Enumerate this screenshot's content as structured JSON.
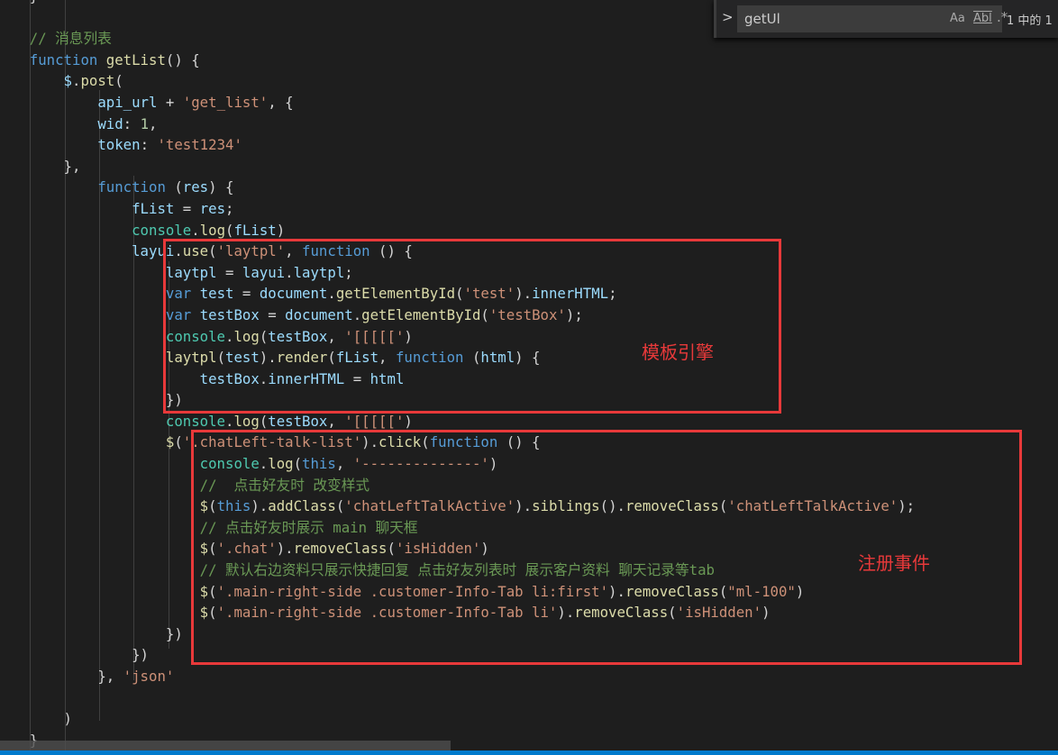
{
  "find_widget": {
    "query": "getUl",
    "match_case_label": "Aa",
    "whole_word_label": "Abl",
    "regex_label": ".*",
    "result_count": "1 中的 1"
  },
  "annotations": {
    "template_engine_label": "模板引擎",
    "register_events_label": "注册事件",
    "color": "#e8393a"
  },
  "code_lines": [
    [
      [
        "p",
        "    }"
      ]
    ],
    [],
    [
      [
        "c",
        "    // 消息列表"
      ]
    ],
    [
      [
        "k",
        "    function "
      ],
      [
        "f",
        "getList"
      ],
      [
        "p",
        "() {"
      ]
    ],
    [
      [
        "v",
        "        $"
      ],
      [
        "p",
        "."
      ],
      [
        "f",
        "post"
      ],
      [
        "p",
        "("
      ]
    ],
    [
      [
        "v",
        "            api_url"
      ],
      [
        "p",
        " + "
      ],
      [
        "s",
        "'get_list'"
      ],
      [
        "p",
        ", {"
      ]
    ],
    [
      [
        "v",
        "            wid"
      ],
      [
        "p",
        ": "
      ],
      [
        "n",
        "1"
      ],
      [
        "p",
        ","
      ]
    ],
    [
      [
        "v",
        "            token"
      ],
      [
        "p",
        ": "
      ],
      [
        "s",
        "'test1234'"
      ]
    ],
    [
      [
        "p",
        "        },"
      ]
    ],
    [
      [
        "k",
        "            function "
      ],
      [
        "p",
        "("
      ],
      [
        "v",
        "res"
      ],
      [
        "p",
        ") {"
      ]
    ],
    [
      [
        "v",
        "                fList"
      ],
      [
        "p",
        " = "
      ],
      [
        "v",
        "res"
      ],
      [
        "p",
        ";"
      ]
    ],
    [
      [
        "t",
        "                console"
      ],
      [
        "p",
        "."
      ],
      [
        "f",
        "log"
      ],
      [
        "p",
        "("
      ],
      [
        "v",
        "fList"
      ],
      [
        "p",
        ")"
      ]
    ],
    [
      [
        "v",
        "                layui"
      ],
      [
        "p",
        "."
      ],
      [
        "f",
        "use"
      ],
      [
        "p",
        "("
      ],
      [
        "s",
        "'laytpl'"
      ],
      [
        "p",
        ", "
      ],
      [
        "k",
        "function"
      ],
      [
        "p",
        " () {"
      ]
    ],
    [
      [
        "v",
        "                    laytpl"
      ],
      [
        "p",
        " = "
      ],
      [
        "v",
        "layui"
      ],
      [
        "p",
        "."
      ],
      [
        "v",
        "laytpl"
      ],
      [
        "p",
        ";"
      ]
    ],
    [
      [
        "k",
        "                    var "
      ],
      [
        "v",
        "test"
      ],
      [
        "p",
        " = "
      ],
      [
        "v",
        "document"
      ],
      [
        "p",
        "."
      ],
      [
        "f",
        "getElementById"
      ],
      [
        "p",
        "("
      ],
      [
        "s",
        "'test'"
      ],
      [
        "p",
        ")."
      ],
      [
        "v",
        "innerHTML"
      ],
      [
        "p",
        ";"
      ]
    ],
    [
      [
        "k",
        "                    var "
      ],
      [
        "v",
        "testBox"
      ],
      [
        "p",
        " = "
      ],
      [
        "v",
        "document"
      ],
      [
        "p",
        "."
      ],
      [
        "f",
        "getElementById"
      ],
      [
        "p",
        "("
      ],
      [
        "s",
        "'testBox'"
      ],
      [
        "p",
        ");"
      ]
    ],
    [
      [
        "t",
        "                    console"
      ],
      [
        "p",
        "."
      ],
      [
        "f",
        "log"
      ],
      [
        "p",
        "("
      ],
      [
        "v",
        "testBox"
      ],
      [
        "p",
        ", "
      ],
      [
        "s",
        "'[[[[['"
      ],
      [
        "p",
        ")"
      ]
    ],
    [
      [
        "f",
        "                    laytpl"
      ],
      [
        "p",
        "("
      ],
      [
        "v",
        "test"
      ],
      [
        "p",
        ")."
      ],
      [
        "f",
        "render"
      ],
      [
        "p",
        "("
      ],
      [
        "v",
        "fList"
      ],
      [
        "p",
        ", "
      ],
      [
        "k",
        "function"
      ],
      [
        "p",
        " ("
      ],
      [
        "v",
        "html"
      ],
      [
        "p",
        ") {"
      ]
    ],
    [
      [
        "v",
        "                        testBox"
      ],
      [
        "p",
        "."
      ],
      [
        "v",
        "innerHTML"
      ],
      [
        "p",
        " = "
      ],
      [
        "v",
        "html"
      ]
    ],
    [
      [
        "p",
        "                    })"
      ]
    ],
    [
      [
        "t",
        "                    console"
      ],
      [
        "p",
        "."
      ],
      [
        "f",
        "log"
      ],
      [
        "p",
        "("
      ],
      [
        "v",
        "testBox"
      ],
      [
        "p",
        ", "
      ],
      [
        "s",
        "'[[[[['"
      ],
      [
        "p",
        ")"
      ]
    ],
    [
      [
        "f",
        "                    $"
      ],
      [
        "p",
        "("
      ],
      [
        "s",
        "'.chatLeft-talk-list'"
      ],
      [
        "p",
        ")."
      ],
      [
        "f",
        "click"
      ],
      [
        "p",
        "("
      ],
      [
        "k",
        "function"
      ],
      [
        "p",
        " () {"
      ]
    ],
    [
      [
        "t",
        "                        console"
      ],
      [
        "p",
        "."
      ],
      [
        "f",
        "log"
      ],
      [
        "p",
        "("
      ],
      [
        "k",
        "this"
      ],
      [
        "p",
        ", "
      ],
      [
        "s",
        "'--------------'"
      ],
      [
        "p",
        ")"
      ]
    ],
    [
      [
        "c",
        "                        //  点击好友时 改变样式"
      ]
    ],
    [
      [
        "f",
        "                        $"
      ],
      [
        "p",
        "("
      ],
      [
        "k",
        "this"
      ],
      [
        "p",
        ")."
      ],
      [
        "f",
        "addClass"
      ],
      [
        "p",
        "("
      ],
      [
        "s",
        "'chatLeftTalkActive'"
      ],
      [
        "p",
        ")."
      ],
      [
        "f",
        "siblings"
      ],
      [
        "p",
        "()."
      ],
      [
        "f",
        "removeClass"
      ],
      [
        "p",
        "("
      ],
      [
        "s",
        "'chatLeftTalkActive'"
      ],
      [
        "p",
        ");"
      ]
    ],
    [
      [
        "c",
        "                        // 点击好友时展示 main 聊天框"
      ]
    ],
    [
      [
        "f",
        "                        $"
      ],
      [
        "p",
        "("
      ],
      [
        "s",
        "'.chat'"
      ],
      [
        "p",
        ")."
      ],
      [
        "f",
        "removeClass"
      ],
      [
        "p",
        "("
      ],
      [
        "s",
        "'isHidden'"
      ],
      [
        "p",
        ")"
      ]
    ],
    [
      [
        "c",
        "                        // 默认右边资料只展示快捷回复 点击好友列表时 展示客户资料 聊天记录等tab"
      ]
    ],
    [
      [
        "f",
        "                        $"
      ],
      [
        "p",
        "("
      ],
      [
        "s",
        "'.main-right-side .customer-Info-Tab li:first'"
      ],
      [
        "p",
        ")."
      ],
      [
        "f",
        "removeClass"
      ],
      [
        "p",
        "("
      ],
      [
        "s",
        "\"ml-100\""
      ],
      [
        "p",
        ")"
      ]
    ],
    [
      [
        "f",
        "                        $"
      ],
      [
        "p",
        "("
      ],
      [
        "s",
        "'.main-right-side .customer-Info-Tab li'"
      ],
      [
        "p",
        ")."
      ],
      [
        "f",
        "removeClass"
      ],
      [
        "p",
        "("
      ],
      [
        "s",
        "'isHidden'"
      ],
      [
        "p",
        ")"
      ]
    ],
    [
      [
        "p",
        "                    })"
      ]
    ],
    [
      [
        "p",
        "                })"
      ]
    ],
    [
      [
        "p",
        "            }, "
      ],
      [
        "s",
        "'json'"
      ]
    ],
    [],
    [
      [
        "p",
        "        )"
      ]
    ],
    [
      [
        "p",
        "    }"
      ]
    ]
  ]
}
